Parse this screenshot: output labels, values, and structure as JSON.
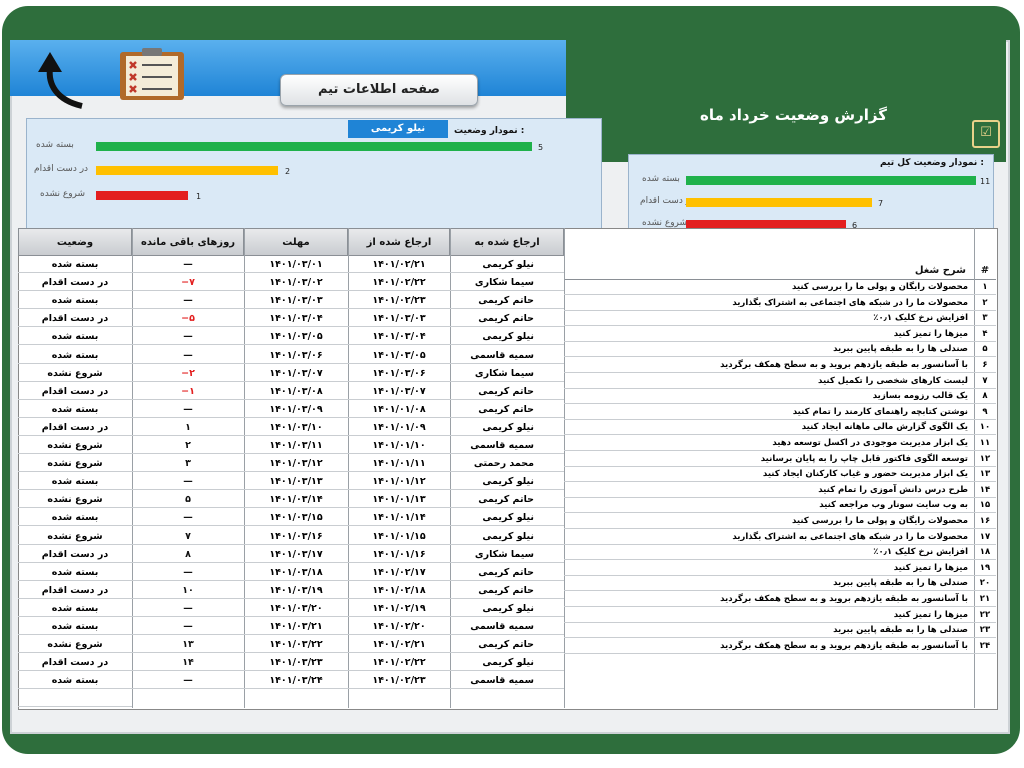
{
  "header": {
    "title": "گزارش وضعیت خرداد ماه",
    "page_button": "صفحه اطلاعات تیم",
    "title_icon": "checklist-icon",
    "back_icon": "curved-arrow-up-icon",
    "clipboard_icon": "clipboard-checklist-icon"
  },
  "colors": {
    "done": "#1fb14b",
    "in_progress": "#ffc000",
    "not_started": "#e31f1f",
    "board": "#2e6e3c",
    "accent": "#1f84d6"
  },
  "member_chart": {
    "label": "نمودار وضعیت :",
    "selected_member": "نیلو کریمی",
    "bars": [
      {
        "label": "بسته شده",
        "value": "5"
      },
      {
        "label": "در دست اقدام",
        "value": "2"
      },
      {
        "label": "شروع نشده",
        "value": "1"
      }
    ]
  },
  "team_chart": {
    "label": "نمودار وضعیت کل تیم :",
    "bars": [
      {
        "label": "بسته شده",
        "value": "11"
      },
      {
        "label": "در دست اقدام",
        "value": "7"
      },
      {
        "label": "شروع نشده",
        "value": "6"
      }
    ]
  },
  "chart_data": [
    {
      "type": "bar",
      "title": "نمودار وضعیت :",
      "categories": [
        "بسته شده",
        "در دست اقدام",
        "شروع نشده"
      ],
      "values": [
        5,
        2,
        1
      ]
    },
    {
      "type": "bar",
      "title": "نمودار وضعیت کل تیم :",
      "categories": [
        "بسته شده",
        "در دست اقدام",
        "شروع نشده"
      ],
      "values": [
        11,
        7,
        6
      ]
    }
  ],
  "table": {
    "columns": {
      "num": "#",
      "desc": "شرح شغل",
      "assignee": "ارجاع شده به",
      "from": "ارجاع شده از",
      "deadline": "مهلت",
      "days_left": "روزهای باقی مانده",
      "status": "وضعیت"
    },
    "rows": [
      {
        "num": "۱",
        "desc": "محصولات رایگان و پولی ما را بررسی کنید",
        "assignee": "نیلو کریمی",
        "from": "۱۴۰۱/۰۲/۲۱",
        "deadline": "۱۴۰۱/۰۳/۰۱",
        "days": "—",
        "status": "بسته شده",
        "days_red": false
      },
      {
        "num": "۲",
        "desc": "محصولات ما را در شبکه های اجتماعی به اشتراک بگذارید",
        "assignee": "سیما شکاری",
        "from": "۱۴۰۱/۰۲/۲۲",
        "deadline": "۱۴۰۱/۰۳/۰۲",
        "days": "−۷",
        "status": "در دست اقدام",
        "days_red": true
      },
      {
        "num": "۳",
        "desc": "افزایش نرخ کلیک ۰٫۱٪",
        "assignee": "حاتم کریمی",
        "from": "۱۴۰۱/۰۲/۲۳",
        "deadline": "۱۴۰۱/۰۳/۰۳",
        "days": "—",
        "status": "بسته شده",
        "days_red": false
      },
      {
        "num": "۴",
        "desc": "میزها را تمیز کنید",
        "assignee": "حاتم کریمی",
        "from": "۱۴۰۱/۰۳/۰۳",
        "deadline": "۱۴۰۱/۰۳/۰۴",
        "days": "−۵",
        "status": "در دست اقدام",
        "days_red": true
      },
      {
        "num": "۵",
        "desc": "صندلی ها را به طبقه پایین ببرید",
        "assignee": "نیلو کریمی",
        "from": "۱۴۰۱/۰۳/۰۴",
        "deadline": "۱۴۰۱/۰۳/۰۵",
        "days": "—",
        "status": "بسته شده",
        "days_red": false
      },
      {
        "num": "۶",
        "desc": "با آسانسور به طبقه یازدهم بروید و به سطح همکف برگردید",
        "assignee": "سمیه قاسمی",
        "from": "۱۴۰۱/۰۳/۰۵",
        "deadline": "۱۴۰۱/۰۳/۰۶",
        "days": "—",
        "status": "بسته شده",
        "days_red": false
      },
      {
        "num": "۷",
        "desc": "لیست کارهای شخصی را تکمیل کنید",
        "assignee": "سیما شکاری",
        "from": "۱۴۰۱/۰۳/۰۶",
        "deadline": "۱۴۰۱/۰۳/۰۷",
        "days": "−۲",
        "status": "شروع نشده",
        "days_red": true
      },
      {
        "num": "۸",
        "desc": "یک قالب رزومه بسازید",
        "assignee": "حاتم کریمی",
        "from": "۱۴۰۱/۰۳/۰۷",
        "deadline": "۱۴۰۱/۰۳/۰۸",
        "days": "−۱",
        "status": "در دست اقدام",
        "days_red": true
      },
      {
        "num": "۹",
        "desc": "نوشتن کتابچه راهنمای کارمند را تمام کنید",
        "assignee": "حاتم کریمی",
        "from": "۱۴۰۱/۰۱/۰۸",
        "deadline": "۱۴۰۱/۰۳/۰۹",
        "days": "—",
        "status": "بسته شده",
        "days_red": false
      },
      {
        "num": "۱۰",
        "desc": "یک الگوی گزارش مالی ماهانه ایجاد کنید",
        "assignee": "نیلو کریمی",
        "from": "۱۴۰۱/۰۱/۰۹",
        "deadline": "۱۴۰۱/۰۳/۱۰",
        "days": "۱",
        "status": "در دست اقدام",
        "days_red": false
      },
      {
        "num": "۱۱",
        "desc": "یک ابزار مدیریت موجودی در اکسل توسعه دهید",
        "assignee": "سمیه قاسمی",
        "from": "۱۴۰۱/۰۱/۱۰",
        "deadline": "۱۴۰۱/۰۳/۱۱",
        "days": "۲",
        "status": "شروع نشده",
        "days_red": false
      },
      {
        "num": "۱۲",
        "desc": "توسعه الگوی فاکتور قابل چاپ را به پایان برسانید",
        "assignee": "محمد رحمتی",
        "from": "۱۴۰۱/۰۱/۱۱",
        "deadline": "۱۴۰۱/۰۳/۱۲",
        "days": "۳",
        "status": "شروع نشده",
        "days_red": false
      },
      {
        "num": "۱۳",
        "desc": "یک ابزار مدیریت حضور و غیاب کارکنان ایجاد کنید",
        "assignee": "نیلو کریمی",
        "from": "۱۴۰۱/۰۱/۱۲",
        "deadline": "۱۴۰۱/۰۳/۱۳",
        "days": "—",
        "status": "بسته شده",
        "days_red": false
      },
      {
        "num": "۱۴",
        "desc": "طرح درس دانش آموزی را تمام کنید",
        "assignee": "حاتم کریمی",
        "from": "۱۴۰۱/۰۱/۱۳",
        "deadline": "۱۴۰۱/۰۳/۱۴",
        "days": "۵",
        "status": "شروع نشده",
        "days_red": false
      },
      {
        "num": "۱۵",
        "desc": "به وب سایت سونار وب مراجعه کنید",
        "assignee": "نیلو کریمی",
        "from": "۱۴۰۱/۰۱/۱۴",
        "deadline": "۱۴۰۱/۰۳/۱۵",
        "days": "—",
        "status": "بسته شده",
        "days_red": false
      },
      {
        "num": "۱۶",
        "desc": "محصولات رایگان و پولی ما را بررسی کنید",
        "assignee": "نیلو کریمی",
        "from": "۱۴۰۱/۰۱/۱۵",
        "deadline": "۱۴۰۱/۰۳/۱۶",
        "days": "۷",
        "status": "شروع نشده",
        "days_red": false
      },
      {
        "num": "۱۷",
        "desc": "محصولات ما را در شبکه های اجتماعی به اشتراک بگذارید",
        "assignee": "سیما شکاری",
        "from": "۱۴۰۱/۰۱/۱۶",
        "deadline": "۱۴۰۱/۰۳/۱۷",
        "days": "۸",
        "status": "در دست اقدام",
        "days_red": false
      },
      {
        "num": "۱۸",
        "desc": "افزایش نرخ کلیک ۰٫۱٪",
        "assignee": "حاتم کریمی",
        "from": "۱۴۰۱/۰۲/۱۷",
        "deadline": "۱۴۰۱/۰۳/۱۸",
        "days": "—",
        "status": "بسته شده",
        "days_red": false
      },
      {
        "num": "۱۹",
        "desc": "میزها را تمیز کنید",
        "assignee": "حاتم کریمی",
        "from": "۱۴۰۱/۰۲/۱۸",
        "deadline": "۱۴۰۱/۰۳/۱۹",
        "days": "۱۰",
        "status": "در دست اقدام",
        "days_red": false
      },
      {
        "num": "۲۰",
        "desc": "صندلی ها را به طبقه پایین ببرید",
        "assignee": "نیلو کریمی",
        "from": "۱۴۰۱/۰۲/۱۹",
        "deadline": "۱۴۰۱/۰۳/۲۰",
        "days": "—",
        "status": "بسته شده",
        "days_red": false
      },
      {
        "num": "۲۱",
        "desc": "با آسانسور به طبقه یازدهم بروید و به سطح همکف برگردید",
        "assignee": "سمیه قاسمی",
        "from": "۱۴۰۱/۰۲/۲۰",
        "deadline": "۱۴۰۱/۰۳/۲۱",
        "days": "—",
        "status": "بسته شده",
        "days_red": false
      },
      {
        "num": "۲۲",
        "desc": "میزها را تمیز کنید",
        "assignee": "حاتم کریمی",
        "from": "۱۴۰۱/۰۲/۲۱",
        "deadline": "۱۴۰۱/۰۳/۲۲",
        "days": "۱۳",
        "status": "شروع نشده",
        "days_red": false
      },
      {
        "num": "۲۳",
        "desc": "صندلی ها را به طبقه پایین ببرید",
        "assignee": "نیلو کریمی",
        "from": "۱۴۰۱/۰۲/۲۲",
        "deadline": "۱۴۰۱/۰۳/۲۳",
        "days": "۱۴",
        "status": "در دست اقدام",
        "days_red": false
      },
      {
        "num": "۲۴",
        "desc": "با آسانسور به طبقه یازدهم بروید و به سطح همکف برگردید",
        "assignee": "سمیه قاسمی",
        "from": "۱۴۰۱/۰۲/۲۳",
        "deadline": "۱۴۰۱/۰۳/۲۴",
        "days": "—",
        "status": "بسته شده",
        "days_red": false
      }
    ]
  }
}
